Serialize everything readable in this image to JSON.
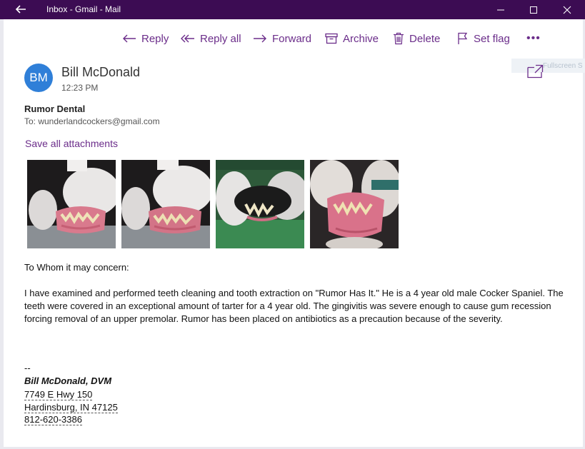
{
  "window": {
    "title": "Inbox - Gmail - Mail"
  },
  "toolbar": {
    "reply": "Reply",
    "reply_all": "Reply all",
    "forward": "Forward",
    "archive": "Archive",
    "delete": "Delete",
    "set_flag": "Set flag",
    "more": "•••"
  },
  "background_fragment": "Fullscreen S",
  "message": {
    "avatar_initials": "BM",
    "sender": "Bill McDonald",
    "time": "12:23 PM",
    "subject": "Rumor Dental",
    "to": "To: wunderlandcockers@gmail.com",
    "save_attachments": "Save all attachments",
    "greeting": "To Whom it may concern:",
    "body": "I have examined and performed teeth cleaning and tooth extraction on \"Rumor Has It.\"  He is a 4 year old male Cocker Spaniel.  The teeth were covered in an exceptional amount of tarter for a 4 year old.  The gingivitis was severe enough to cause gum recession forcing removal of an upper premolar.  Rumor has been placed on antibiotics as a precaution because of the severity.",
    "signature": {
      "dash": "--",
      "name": "Bill McDonald, DVM",
      "address1": "7749 E Hwy 150",
      "address2": "Hardinsburg, IN 47125",
      "phone": "812-620-3386"
    }
  },
  "colors": {
    "titlebar": "#3c0c53",
    "accent": "#6b2d8a",
    "avatar": "#2f7fd8"
  }
}
